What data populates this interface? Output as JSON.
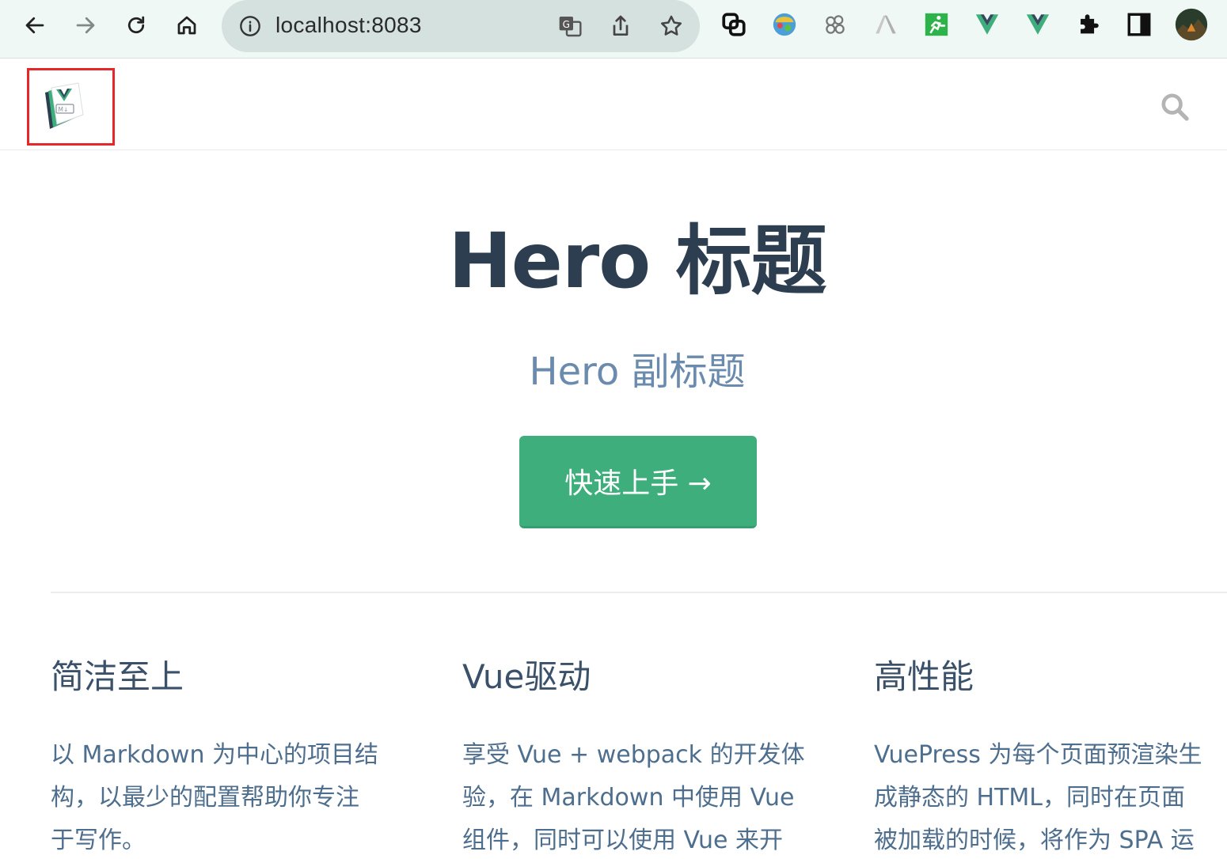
{
  "browser": {
    "url": "localhost:8083",
    "extensions": [
      "link-icon",
      "colorful-extension-icon",
      "paw-extension-icon",
      "a-logo-extension-icon",
      "green-runner-extension-icon",
      "vue-devtools-icon",
      "vue-devtools-icon-2",
      "puzzle-extensions-icon",
      "side-panel-icon",
      "profile-avatar"
    ]
  },
  "navbar": {
    "logo_text": "M↓"
  },
  "hero": {
    "title": "Hero 标题",
    "subtitle": "Hero 副标题",
    "action": "快速上手 →"
  },
  "features": [
    {
      "title": "简洁至上",
      "lines": [
        "以 Markdown 为中心的项目结",
        "构，以最少的配置帮助你专注",
        "于写作。"
      ]
    },
    {
      "title": "Vue驱动",
      "lines": [
        "享受 Vue + webpack 的开发体",
        "验，在 Markdown 中使用 Vue",
        "组件，同时可以使用 Vue 来开"
      ]
    },
    {
      "title": "高性能",
      "lines": [
        "VuePress 为每个页面预渲染生",
        "成静态的 HTML，同时在页面",
        "被加载的时候，将作为 SPA 运"
      ]
    }
  ],
  "colors": {
    "accent": "#3eaf7c",
    "title": "#2c3e50",
    "subtitle": "#6a8bad",
    "highlight_box": "#e5262a"
  }
}
